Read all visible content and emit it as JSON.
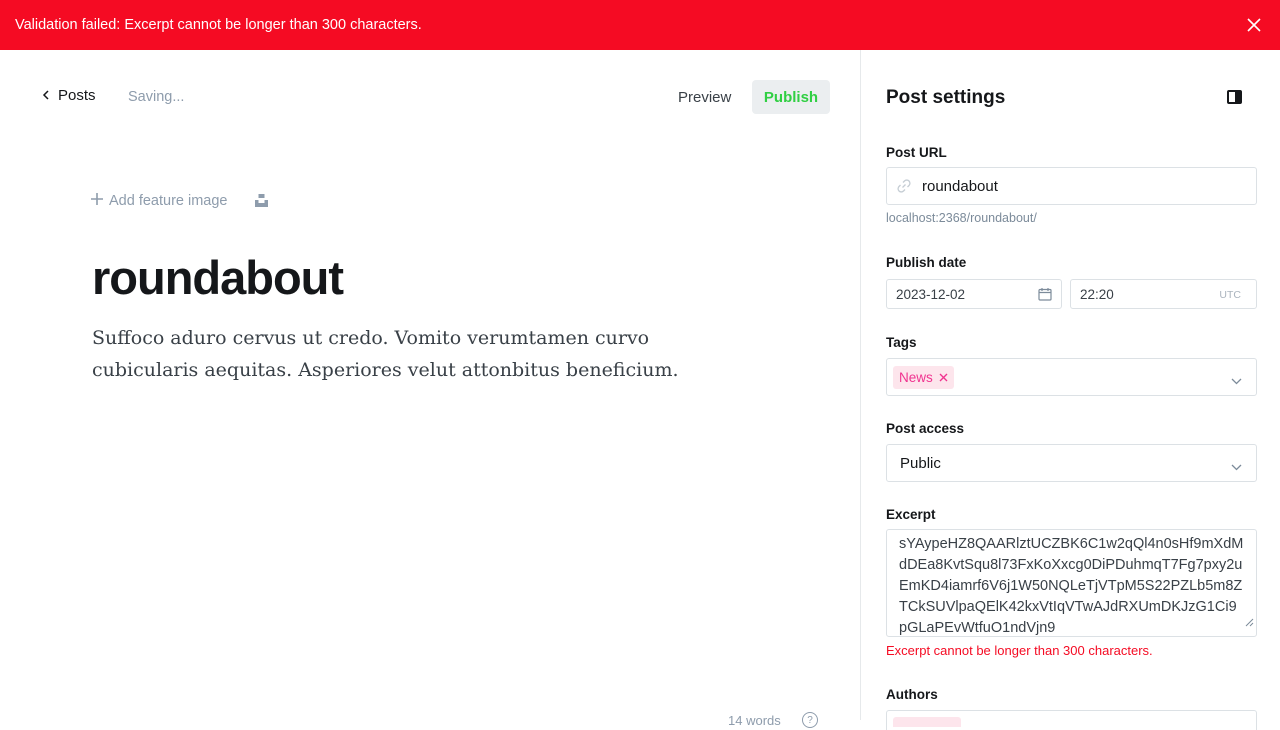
{
  "alert": {
    "message": "Validation failed: Excerpt cannot be longer than 300 characters."
  },
  "editor": {
    "back_label": "Posts",
    "status": "Saving...",
    "preview_label": "Preview",
    "publish_label": "Publish",
    "feature_image_label": "Add feature image",
    "title": "roundabout",
    "body": "Suffoco aduro cervus ut credo. Vomito verumtamen curvo cubicularis aequitas. Asperiores velut attonbitus beneficium.",
    "word_count": "14 words"
  },
  "settings": {
    "title": "Post settings",
    "post_url": {
      "label": "Post URL",
      "value": "roundabout",
      "hint": "localhost:2368/roundabout/"
    },
    "publish_date": {
      "label": "Publish date",
      "date": "2023-12-02",
      "time": "22:20",
      "timezone": "UTC"
    },
    "tags": {
      "label": "Tags",
      "items": [
        "News"
      ]
    },
    "post_access": {
      "label": "Post access",
      "value": "Public"
    },
    "excerpt": {
      "label": "Excerpt",
      "value": "sYAypeHZ8QAARlztUCZBK6C1w2qQl4n0sHf9mXdMdDEa8KvtSqu8l73FxKoXxcg0DiPDuhmqT7Fg7pxy2uEmKD4iamrf6V6j1W50NQLeTjVTpM5S22PZLb5m8ZTCkSUVlpaQElK42kxVtIqVTwAJdRXUmDKJzG1Ci9pGLaPEvWtfuO1ndVjn9",
      "error": "Excerpt cannot be longer than 300 characters."
    },
    "authors": {
      "label": "Authors"
    }
  },
  "colors": {
    "alert_bg": "#f50b23",
    "publish_text": "#30cf43",
    "tag_bg": "#fde5ec",
    "tag_text": "#f0338f",
    "error_text": "#f50b23"
  },
  "icons": [
    "close-icon",
    "chevron-left-icon",
    "plus-icon",
    "unsplash-icon",
    "sidebar-toggle-icon",
    "link-icon",
    "calendar-icon",
    "chevron-down-icon",
    "help-icon"
  ]
}
